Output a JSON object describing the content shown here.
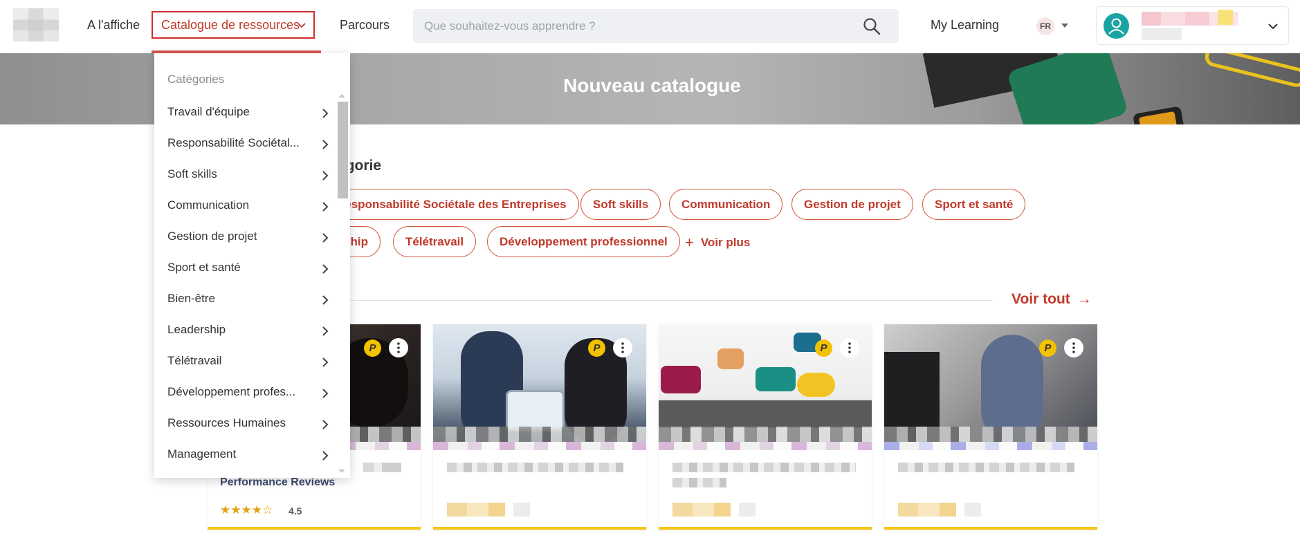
{
  "header": {
    "nav": {
      "affiche": "A l'affiche",
      "catalogue": "Catalogue de ressources",
      "parcours": "Parcours",
      "my_learning": "My Learning"
    },
    "search": {
      "placeholder": "Que souhaitez-vous apprendre ?",
      "value": ""
    },
    "language": "FR",
    "icons": {
      "search": "search-icon",
      "user": "user-icon",
      "dropdown": "chevron-down-icon"
    }
  },
  "banner": {
    "title": "Nouveau catalogue"
  },
  "category_section": {
    "title_visible": "égorie",
    "chips": [
      "Responsabilité Sociétale des Entreprises",
      "Soft skills",
      "Communication",
      "Gestion de projet",
      "Sport et santé",
      "hip",
      "Télétravail",
      "Développement professionnel"
    ],
    "voir_plus": "Voir plus"
  },
  "list": {
    "voir_tout": "Voir tout",
    "cards": [
      {
        "title_visible": "Performance Reviews",
        "title_tail": "s",
        "stars": "★★★★☆",
        "rating": "4.5",
        "badge": "P"
      },
      {
        "badge": "P"
      },
      {
        "badge": "P"
      },
      {
        "badge": "P"
      }
    ]
  },
  "dropdown": {
    "title": "Catégories",
    "items": [
      "Travail d'équipe",
      "Responsabilité Sociétal...",
      "Soft skills",
      "Communication",
      "Gestion de projet",
      "Sport et santé",
      "Bien-être",
      "Leadership",
      "Télétravail",
      "Développement profes...",
      "Ressources Humaines",
      "Management"
    ]
  },
  "colors": {
    "accent": "#c0392b",
    "border_accent": "#d32f2f",
    "star": "#e2a20b",
    "card_bar": "#f5c518",
    "avatar": "#1aa3a3"
  }
}
